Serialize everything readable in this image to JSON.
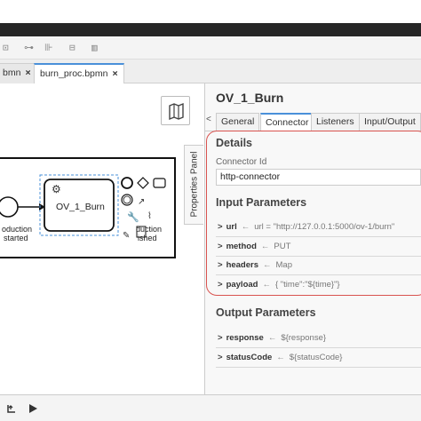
{
  "toolbar": {
    "icons": [
      "grid-icon",
      "branch-icon",
      "columns-icon",
      "distribute-icon",
      "bar-chart-icon"
    ]
  },
  "file_tabs": [
    {
      "label": "bmn",
      "close": "×"
    },
    {
      "label": "burn_proc.bpmn",
      "close": "×"
    }
  ],
  "diagram": {
    "task_label": "OV_1_Burn",
    "start_label_line1": "oduction",
    "start_label_line2": "started",
    "end_label_line1": "duction",
    "end_label_line2": "ished"
  },
  "properties_toggle": "Properties Panel",
  "panel": {
    "title": "OV_1_Burn",
    "tabs": [
      "General",
      "Connector",
      "Listeners",
      "Input/Output"
    ],
    "active_tab": "Connector",
    "details_title": "Details",
    "connector_id_label": "Connector Id",
    "connector_id_value": "http-connector",
    "input_params_title": "Input Parameters",
    "input_params": [
      {
        "name": "url",
        "value": "url = \"http://127.0.0.1:5000/ov-1/burn\""
      },
      {
        "name": "method",
        "value": "PUT"
      },
      {
        "name": "headers",
        "value": "Map"
      },
      {
        "name": "payload",
        "value": "{ \"time\":\"${time}\"}"
      }
    ],
    "output_params_title": "Output Parameters",
    "output_params": [
      {
        "name": "response",
        "value": "${response}"
      },
      {
        "name": "statusCode",
        "value": "${statusCode}"
      }
    ]
  },
  "colors": {
    "accent": "#4a90d9",
    "highlight": "#d9534f",
    "title_bar": "#262626"
  }
}
